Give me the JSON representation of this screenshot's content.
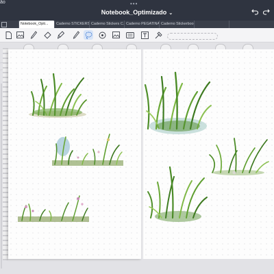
{
  "status": {
    "time": "ão"
  },
  "titlebar": {
    "title": "Notebook_Optimizado",
    "caret": "⌄",
    "dots": "•••"
  },
  "nav": {
    "undo_icon": "undo-icon",
    "redo_icon": "redo-icon"
  },
  "tabs": [
    {
      "label": "",
      "icon": "tab-add-icon"
    },
    {
      "label": "Notebook_Opti...",
      "active": true
    },
    {
      "label": "Caderno STICKERS"
    },
    {
      "label": "Caderno Stickers C..."
    },
    {
      "label": "Caderno PEGATINAS"
    },
    {
      "label": "Caderno Stickerbook"
    },
    {
      "label": ""
    },
    {
      "label": ""
    }
  ],
  "toolbar": {
    "tools": [
      "document-icon",
      "image-picker-icon",
      "pen-icon",
      "eraser-icon",
      "highlighter-icon",
      "lasso-icon",
      "shapes-icon",
      "image-icon",
      "camera-icon",
      "sticker-icon",
      "text-icon",
      "laser-pointer-icon"
    ],
    "selected": "lasso-icon"
  },
  "colors": {
    "header": "#2f3440",
    "tabbar": "#3a3f4a",
    "accent": "#2e6fd1",
    "page": "#fdfdfd"
  }
}
